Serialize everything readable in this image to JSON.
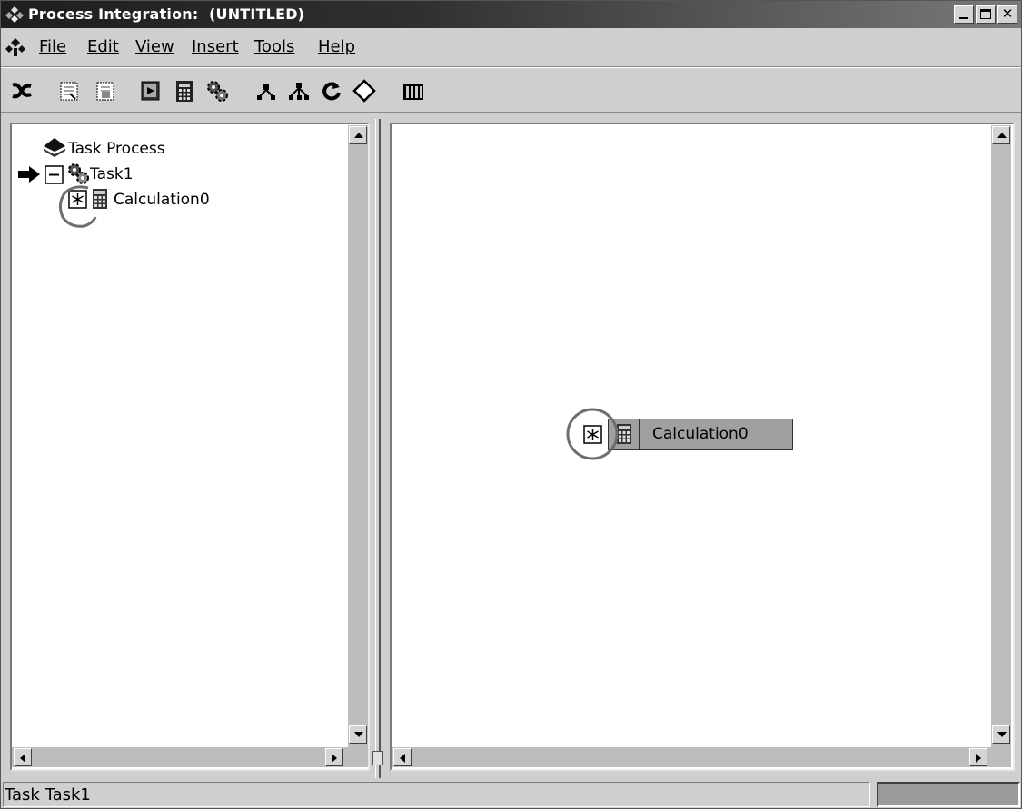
{
  "window": {
    "title": "Process Integration:  (UNTITLED)",
    "minimize_icon": "minimize-icon",
    "maximize_icon": "maximize-icon",
    "close_icon": "close-icon"
  },
  "menubar": {
    "items": [
      {
        "label": "File"
      },
      {
        "label": "Edit"
      },
      {
        "label": "View"
      },
      {
        "label": "Insert"
      },
      {
        "label": "Tools"
      },
      {
        "label": "Help"
      }
    ]
  },
  "toolbar": {
    "icons": [
      "cut-icon",
      "copy-icon",
      "paste-icon",
      "run-icon",
      "calculator-icon",
      "gears-icon",
      "branch-icon",
      "fork-icon",
      "loop-icon",
      "decision-icon",
      "library-icon"
    ]
  },
  "tree": {
    "root": "Task Process",
    "task": "Task1",
    "child": "Calculation0"
  },
  "canvas": {
    "node_label": "Calculation0"
  },
  "status": {
    "text": "Task Task1"
  },
  "colors": {
    "highlight_circle": "#6e6e6e",
    "node_fill": "#a0a0a0"
  }
}
